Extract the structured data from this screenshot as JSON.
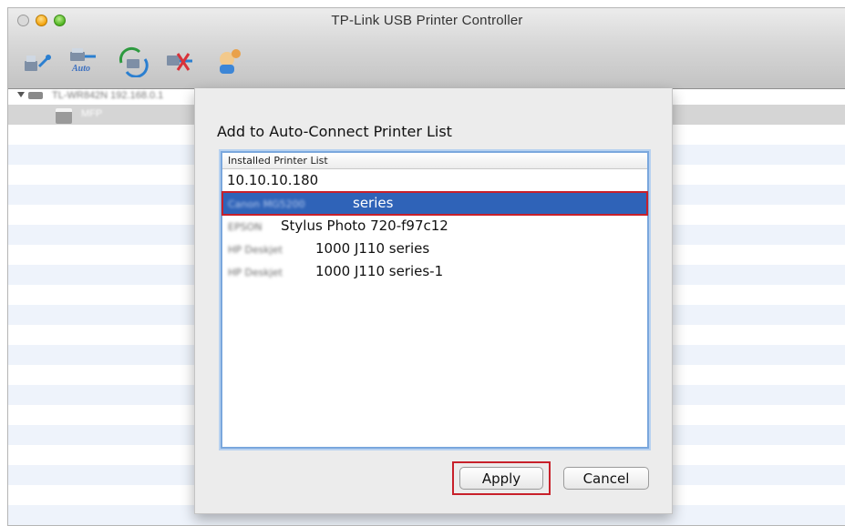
{
  "window": {
    "title": "TP-Link USB Printer Controller"
  },
  "toolbar": {
    "icons": [
      "connect-icon",
      "auto-connect-icon",
      "refresh-icon",
      "disconnect-icon",
      "help-icon"
    ],
    "auto_badge": "Auto"
  },
  "tree": {
    "device_label": "TL-WR842N 192.168.0.1",
    "printer_label": "MFP"
  },
  "dialog": {
    "title": "Add to Auto-Connect Printer List",
    "list_header": "Installed Printer List",
    "items": [
      {
        "prefix": "",
        "text": "10.10.10.180",
        "selected": false
      },
      {
        "prefix": "Canon MG5200",
        "text": "series",
        "selected": true
      },
      {
        "prefix": "EPSON",
        "text": "Stylus Photo 720-f97c12",
        "selected": false
      },
      {
        "prefix": "HP Deskjet",
        "text": "1000 J110 series",
        "selected": false
      },
      {
        "prefix": "HP Deskjet",
        "text": "1000 J110 series-1",
        "selected": false
      }
    ],
    "apply_label": "Apply",
    "cancel_label": "Cancel"
  },
  "colors": {
    "selection": "#2f63b8",
    "highlight_box": "#c8202a",
    "list_stripe": "#eef3fb"
  }
}
